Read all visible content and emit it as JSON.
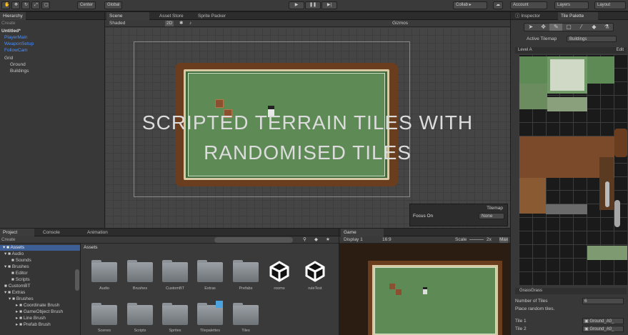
{
  "toolbar": {
    "pivot": "Center",
    "space": "Global",
    "collab": "Collab ▸",
    "account": "Account",
    "layers": "Layers",
    "layout": "Layout"
  },
  "hierarchy": {
    "tab": "Hierarchy",
    "search": "Create",
    "items": [
      "Untitled*",
      "PlayerMain",
      "WeaponSetup",
      "FollowCam",
      "Grid",
      "Ground",
      "Buildings"
    ]
  },
  "scene": {
    "tabs": [
      "Scene",
      "Asset Store",
      "Sprite Packer"
    ],
    "shading": "Shaded",
    "mode2d": "2D",
    "gizmos": "Gizmos"
  },
  "overlay": {
    "line1": "SCRIPTED TERRAIN TILES WITH",
    "line2": "RANDOMISED TILES"
  },
  "tilemap_widget": {
    "title": "Tilemap",
    "label": "Focus On",
    "value": "None"
  },
  "inspector": {
    "tabs": [
      "Inspector",
      "Tile Palette"
    ],
    "active_tilemap_label": "Active Tilemap",
    "active_tilemap_value": "Buildings",
    "palette": "Level A",
    "edit": "Edit",
    "brush": "GrassGrass",
    "num_tiles_label": "Number of Tiles",
    "num_tiles_value": "6",
    "place_random": "Place random tiles.",
    "tile1_label": "Tile 1",
    "tile1_value": "Ground_A0_",
    "tile2_label": "Tile 2",
    "tile2_value": "Ground_A0_"
  },
  "project": {
    "tabs": [
      "Project",
      "Console",
      "Animation"
    ],
    "create": "Create",
    "tree": [
      "Assets",
      "Audio",
      "Sounds",
      "Brushes",
      "Editor",
      "Scripts",
      "CustomBT",
      "Extras",
      "Brushes",
      "Coordinate Brush",
      "GameObject Brush",
      "Line Brush",
      "Prefab Brush"
    ],
    "breadcrumb": "Assets",
    "folders": [
      "Audio",
      "Brushes",
      "CustomBT",
      "Extras",
      "Prefabs",
      "rooms",
      "ruleTest",
      "Scenes",
      "Scripts",
      "Sprites",
      "Tilepalettes",
      "Tiles"
    ]
  },
  "game": {
    "tab": "Game",
    "display": "Display 1",
    "aspect": "16:9",
    "scale": "Scale",
    "scale_value": "2x",
    "max": "Max"
  }
}
